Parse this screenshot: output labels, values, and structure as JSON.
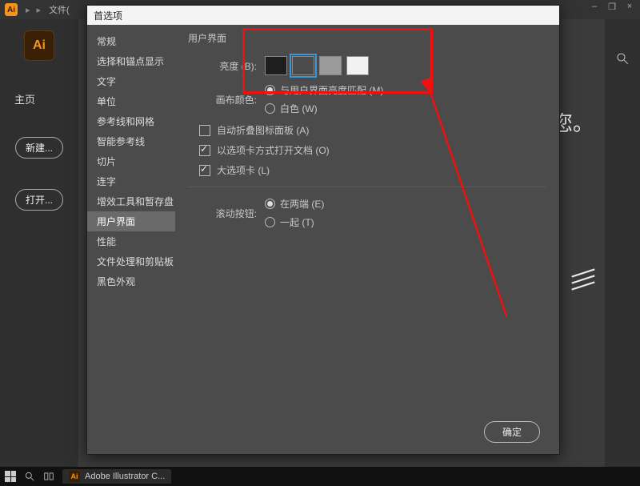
{
  "menubar": {
    "file_label": "文件("
  },
  "win_controls": {
    "min": "–",
    "restore": "❐",
    "close": "×"
  },
  "left_rail": {
    "logo_text": "Ai",
    "home_tab": "主页",
    "new_btn": "新建...",
    "open_btn": "打开..."
  },
  "center": {
    "greeting_tail": "您。"
  },
  "dialog": {
    "title": "首选项",
    "sidebar_items": [
      "常规",
      "选择和锚点显示",
      "文字",
      "单位",
      "参考线和网格",
      "智能参考线",
      "切片",
      "连字",
      "增效工具和暂存盘",
      "用户界面",
      "性能",
      "文件处理和剪贴板",
      "黑色外观"
    ],
    "sidebar_active_index": 9,
    "section_title": "用户界面",
    "brightness_label": "亮度 (B):",
    "brightness_swatches": [
      "#1e1e1e",
      "#4b4b4b",
      "#9b9b9b",
      "#f2f2f2"
    ],
    "brightness_selected_index": 1,
    "canvas_color_label": "画布颜色:",
    "canvas_color_options": [
      "与用户界面亮度匹配 (M)",
      "白色 (W)"
    ],
    "canvas_color_selected_index": 0,
    "checkboxes": [
      {
        "label": "自动折叠图标面板 (A)",
        "checked": false
      },
      {
        "label": "以选项卡方式打开文档 (O)",
        "checked": true
      },
      {
        "label": "大选项卡 (L)",
        "checked": true
      }
    ],
    "scroll_label": "滚动按钮:",
    "scroll_options": [
      "在两端 (E)",
      "一起 (T)"
    ],
    "scroll_selected_index": 0,
    "ok_label": "确定"
  },
  "taskbar": {
    "task_label": "Adobe Illustrator C..."
  }
}
